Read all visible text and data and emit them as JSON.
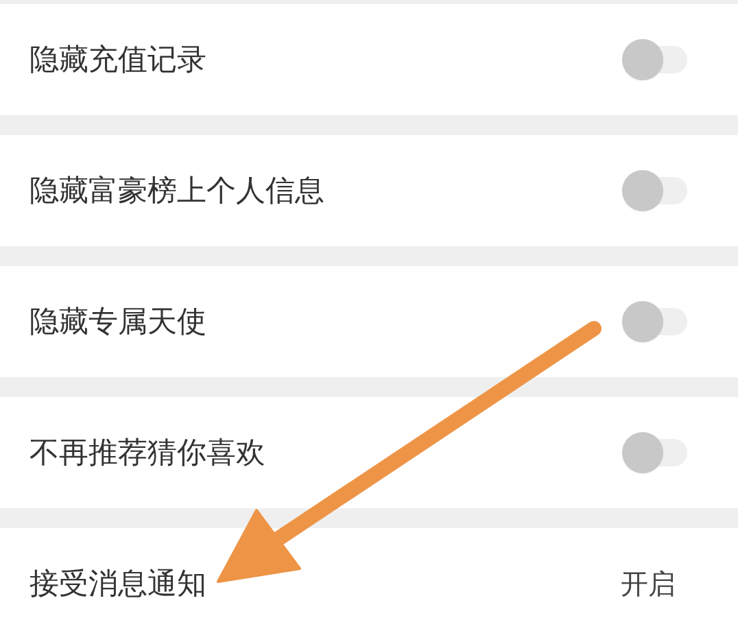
{
  "rows": [
    {
      "kind": "toggle",
      "label": "隐藏充值记录",
      "on": false
    },
    {
      "kind": "toggle",
      "label": "隐藏富豪榜上个人信息",
      "on": false
    },
    {
      "kind": "toggle",
      "label": "隐藏专属天使",
      "on": false
    },
    {
      "kind": "toggle",
      "label": "不再推荐猜你喜欢",
      "on": false
    },
    {
      "kind": "value",
      "label": "接受消息通知",
      "value": "开启"
    }
  ],
  "annotations": [
    {
      "kind": "arrow"
    }
  ]
}
